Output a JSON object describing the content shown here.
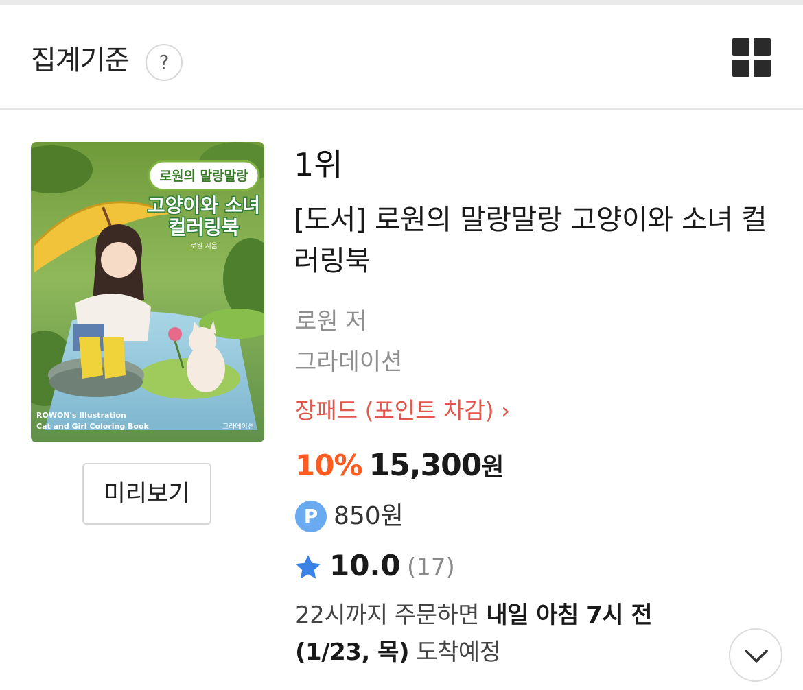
{
  "header": {
    "title": "집계기준",
    "help_label": "?"
  },
  "product": {
    "rank": "1위",
    "title": "[도서] 로원의 말랑말랑 고양이와 소녀 컬러링북",
    "author": "로원 저",
    "publisher": "그라데이션",
    "format_link": "장패드 (포인트 차감) ›",
    "discount": "10%",
    "price": "15,300",
    "price_unit": "원",
    "points": "850원",
    "point_icon_label": "P",
    "rating": "10.0",
    "review_count": "(17)",
    "delivery_prefix": "22시까지 주문하면 ",
    "delivery_bold": "내일 아침 7시 전(1/23, 목)",
    "delivery_suffix": " 도착예정",
    "preview_label": "미리보기",
    "cover": {
      "series_title": "로원의 말랑말랑",
      "title_line1": "고양이와 소녀",
      "title_line2": "컬러링북",
      "author_small": "로원 지음",
      "en_line1": "ROWON's Illustration",
      "en_line2": "Cat and Girl Coloring Book",
      "publisher_small": "그라데이션"
    }
  },
  "colors": {
    "discount": "#ff5a1f",
    "format_link": "#e2574c",
    "star": "#3b82e6",
    "point_badge": "#6aaaf0"
  },
  "icons": {
    "grid": "grid-view-icon",
    "star": "star-icon",
    "expand": "chevron-down-icon"
  }
}
